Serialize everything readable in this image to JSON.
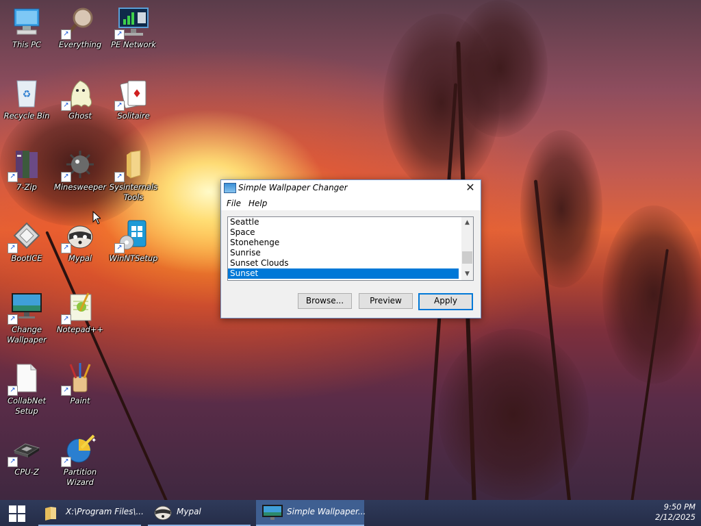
{
  "desktop_icons": [
    {
      "label": "This PC",
      "icon": "computer-icon"
    },
    {
      "label": "Everything",
      "icon": "magnifier-icon"
    },
    {
      "label": "PE Network",
      "icon": "network-icon"
    },
    {
      "label": "Recycle Bin",
      "icon": "recycle-bin-icon"
    },
    {
      "label": "Ghost",
      "icon": "ghost-icon"
    },
    {
      "label": "Solitaire",
      "icon": "playing-cards-icon"
    },
    {
      "label": "7-Zip",
      "icon": "books-icon"
    },
    {
      "label": "Minesweeper",
      "icon": "mine-icon"
    },
    {
      "label": "Sysinternals Tools",
      "icon": "folder-icon"
    },
    {
      "label": "BootICE",
      "icon": "disk-icon"
    },
    {
      "label": "Mypal",
      "icon": "raccoon-icon"
    },
    {
      "label": "WinNTSetup",
      "icon": "windows-setup-icon"
    },
    {
      "label": "Change Wallpaper",
      "icon": "wallpaper-monitor-icon"
    },
    {
      "label": "Notepad++",
      "icon": "notepad-icon"
    },
    {
      "label": "CollabNet Setup",
      "icon": "document-icon"
    },
    {
      "label": "Paint",
      "icon": "paint-brushes-icon"
    },
    {
      "label": "CPU-Z",
      "icon": "cpu-chip-icon"
    },
    {
      "label": "Partition Wizard",
      "icon": "partition-wizard-icon"
    }
  ],
  "dialog": {
    "title": "Simple Wallpaper Changer",
    "close_glyph": "✕",
    "menu": [
      "File",
      "Help"
    ],
    "list_items": [
      "Seattle",
      "Space",
      "Stonehenge",
      "Sunrise",
      "Sunset Clouds",
      "Sunset"
    ],
    "selected_item": "Sunset",
    "buttons": {
      "browse": "Browse...",
      "preview": "Preview",
      "apply": "Apply"
    }
  },
  "taskbar": {
    "tasks": [
      {
        "label": "X:\\Program Files\\...",
        "icon": "folder-icon"
      },
      {
        "label": "Mypal",
        "icon": "raccoon-icon"
      },
      {
        "label": "Simple Wallpaper...",
        "icon": "wallpaper-monitor-icon"
      }
    ],
    "time": "9:50 PM",
    "date": "2/12/2025"
  },
  "colors": {
    "selection": "#0078d7",
    "taskbar": "#2a3350",
    "active_task": "#3f5f91"
  }
}
